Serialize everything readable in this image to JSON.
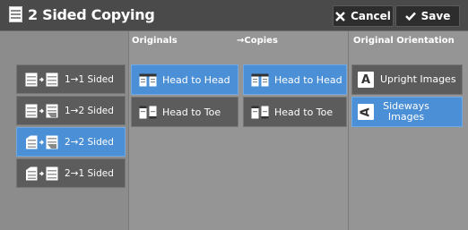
{
  "header": {
    "title": "2 Sided Copying",
    "cancel_label": "Cancel",
    "save_label": "Save"
  },
  "sided_options": [
    {
      "label": "1→1 Sided",
      "selected": false
    },
    {
      "label": "1→2 Sided",
      "selected": false
    },
    {
      "label": "2→2 Sided",
      "selected": true
    },
    {
      "label": "2→1 Sided",
      "selected": false
    }
  ],
  "originals": {
    "heading": "Originals",
    "options": [
      {
        "label": "Head to Head",
        "selected": true
      },
      {
        "label": "Head to Toe",
        "selected": false
      }
    ]
  },
  "copies": {
    "heading": "Copies",
    "arrow": "→",
    "options": [
      {
        "label": "Head to Head",
        "selected": true
      },
      {
        "label": "Head to Toe",
        "selected": false
      }
    ]
  },
  "orientation": {
    "heading": "Original Orientation",
    "options": [
      {
        "label": "Upright Images",
        "letter": "A",
        "selected": false
      },
      {
        "label": "Sideways Images",
        "letter": "A",
        "selected": true
      }
    ]
  },
  "colors": {
    "selected": "#4b8fd6",
    "unselected": "#5c5c5c",
    "header": "#4a4a4a"
  },
  "icons": [
    "document-icon",
    "close-icon",
    "checkmark-icon",
    "one-sided-icon",
    "two-sided-icon",
    "head-to-head-icon",
    "head-to-toe-icon"
  ]
}
